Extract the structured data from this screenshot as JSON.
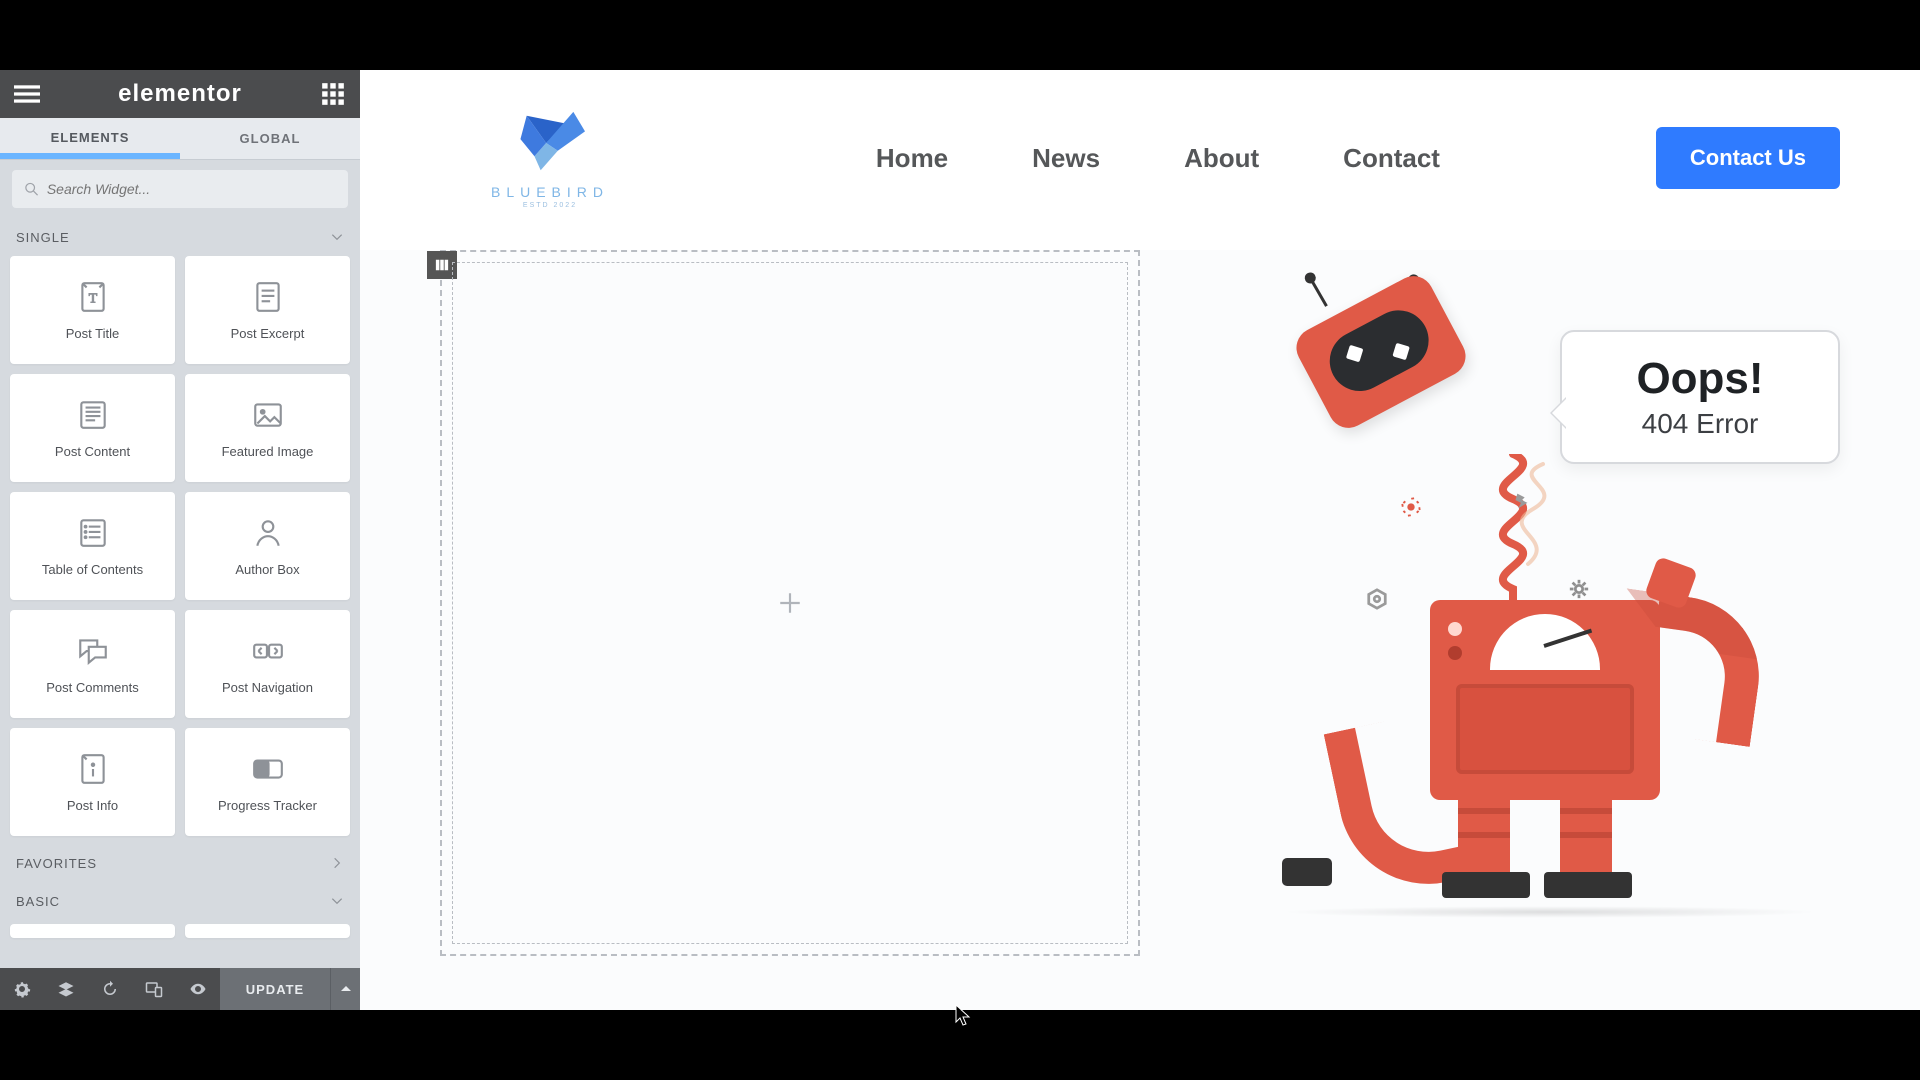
{
  "sidebar": {
    "logo": "elementor",
    "tabs": {
      "elements": "ELEMENTS",
      "global": "GLOBAL"
    },
    "search_placeholder": "Search Widget...",
    "section_single": "SINGLE",
    "section_favorites": "FAVORITES",
    "section_basic": "BASIC",
    "widgets": [
      {
        "id": "post-title",
        "label": "Post Title"
      },
      {
        "id": "post-excerpt",
        "label": "Post Excerpt"
      },
      {
        "id": "post-content",
        "label": "Post Content"
      },
      {
        "id": "featured-image",
        "label": "Featured Image"
      },
      {
        "id": "table-of-contents",
        "label": "Table of Contents"
      },
      {
        "id": "author-box",
        "label": "Author Box"
      },
      {
        "id": "post-comments",
        "label": "Post Comments"
      },
      {
        "id": "post-navigation",
        "label": "Post Navigation"
      },
      {
        "id": "post-info",
        "label": "Post Info"
      },
      {
        "id": "progress-tracker",
        "label": "Progress Tracker"
      }
    ],
    "update_button": "UPDATE"
  },
  "site": {
    "brand_name": "BLUEBIRD",
    "brand_sub": "ESTD 2022",
    "nav": {
      "home": "Home",
      "news": "News",
      "about": "About",
      "contact": "Contact"
    },
    "cta": "Contact Us"
  },
  "error": {
    "title": "Oops!",
    "subtitle": "404 Error"
  },
  "colors": {
    "accent": "#2f7bff",
    "robot": "#e05a47"
  }
}
